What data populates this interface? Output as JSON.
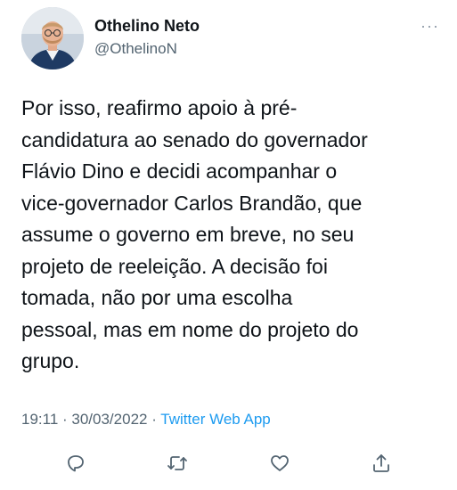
{
  "author": {
    "name": "Othelino Neto",
    "handle": "@OthelinoN"
  },
  "more_menu": "···",
  "tweet": {
    "text": "Por isso, reafirmo apoio à pré-\ncandidatura ao senado do governador\nFlávio Dino e decidi acompanhar o\nvice-governador Carlos Brandão, que\nassume o governo em breve, no seu\nprojeto de reeleição. A decisão foi\ntomada, não por uma escolha\npessoal, mas em nome do projeto do\ngrupo."
  },
  "meta": {
    "time": "19:11",
    "separator1": " · ",
    "date": "30/03/2022",
    "separator2": " · ",
    "source": "Twitter Web App"
  },
  "actions": [
    {
      "icon": "reply-icon"
    },
    {
      "icon": "retweet-icon"
    },
    {
      "icon": "like-icon"
    },
    {
      "icon": "share-icon"
    }
  ],
  "colors": {
    "text": "#0f1419",
    "secondary": "#536471",
    "link": "#1d9bf0"
  }
}
